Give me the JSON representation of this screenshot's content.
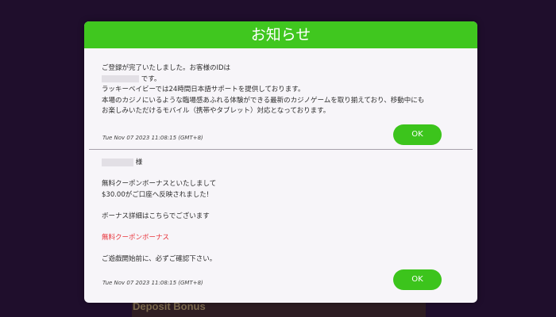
{
  "background": {
    "label": "Deposit Bonus"
  },
  "modal": {
    "title": "お知らせ",
    "header_color": "#40c71f"
  },
  "messages": [
    {
      "lines": [
        "ご登録が完了いたしました。お客様のIDは",
        "です。",
        "ラッキーベイビーでは24時間日本語サポートを提供しております。",
        "本場のカジノにいるような臨場感あふれる体験ができる最新のカジノゲームを取り揃えており、移動中にも",
        "お楽しみいただけるモバイル（携帯やタブレット）対応となっております。"
      ],
      "timestamp": "Tue Nov 07 2023 11:08:15 (GMT+8)",
      "ok_label": "OK"
    },
    {
      "honorific": "様",
      "lines": [
        "無料クーポンボーナスといたしまして",
        "$30.00がご口座へ反映されました!",
        "ボーナス詳細はこちらでございます",
        "ご遊戯開始前に、必ずご確認下さい。"
      ],
      "link": "無料クーポンボーナス",
      "timestamp": "Tue Nov 07 2023 11:08:15 (GMT+8)",
      "ok_label": "OK"
    }
  ],
  "colors": {
    "button": "#3cc41c",
    "link": "#e8333a"
  }
}
